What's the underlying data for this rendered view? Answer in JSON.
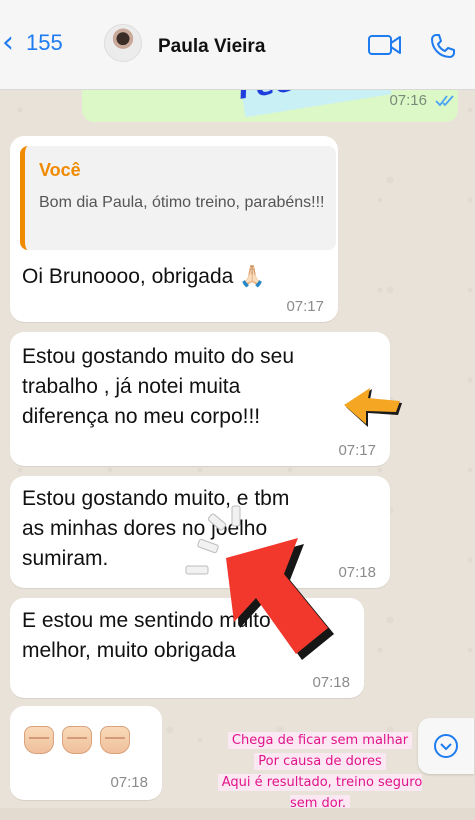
{
  "header": {
    "back_count": "155",
    "contact_name": "Paula Vieira"
  },
  "top_message": {
    "time": "07:16"
  },
  "sticker": {
    "text": "Feedback"
  },
  "messages": [
    {
      "quote_author": "Você",
      "quote_text": "Bom dia Paula, ótimo treino, parabéns!!!",
      "text": "Oi Brunoooo, obrigada 🙏🏻",
      "time": "07:17"
    },
    {
      "text_lines": [
        "Estou gostando muito do seu",
        "trabalho , já notei muita",
        "diferença no meu corpo!!!"
      ],
      "time": "07:17"
    },
    {
      "text_lines": [
        "Estou gostando muito, e tbm",
        "as minhas dores no joelho",
        "sumiram."
      ],
      "time": "07:18"
    },
    {
      "text_lines": [
        "E estou me sentindo muito",
        "melhor, muito obrigada"
      ],
      "time": "07:18"
    },
    {
      "emoji": "👊🏻👊🏻👊🏻",
      "time": "07:18"
    }
  ],
  "overlay_note": {
    "line1": "Chega de ficar sem malhar",
    "line2": "Por causa de dores",
    "line3": "Aqui é resultado, treino seguro sem dor."
  },
  "colors": {
    "accent_blue": "#1f7cf0",
    "quote_orange": "#f08a00",
    "sticker_blue": "#1e3fdb",
    "note_pink": "#e0148a",
    "arrow_red": "#f2382c",
    "arrow_orange": "#f5a623"
  },
  "icons": [
    "chevron-left-icon",
    "video-call-icon",
    "phone-icon",
    "double-check-icon",
    "scroll-down-icon"
  ]
}
